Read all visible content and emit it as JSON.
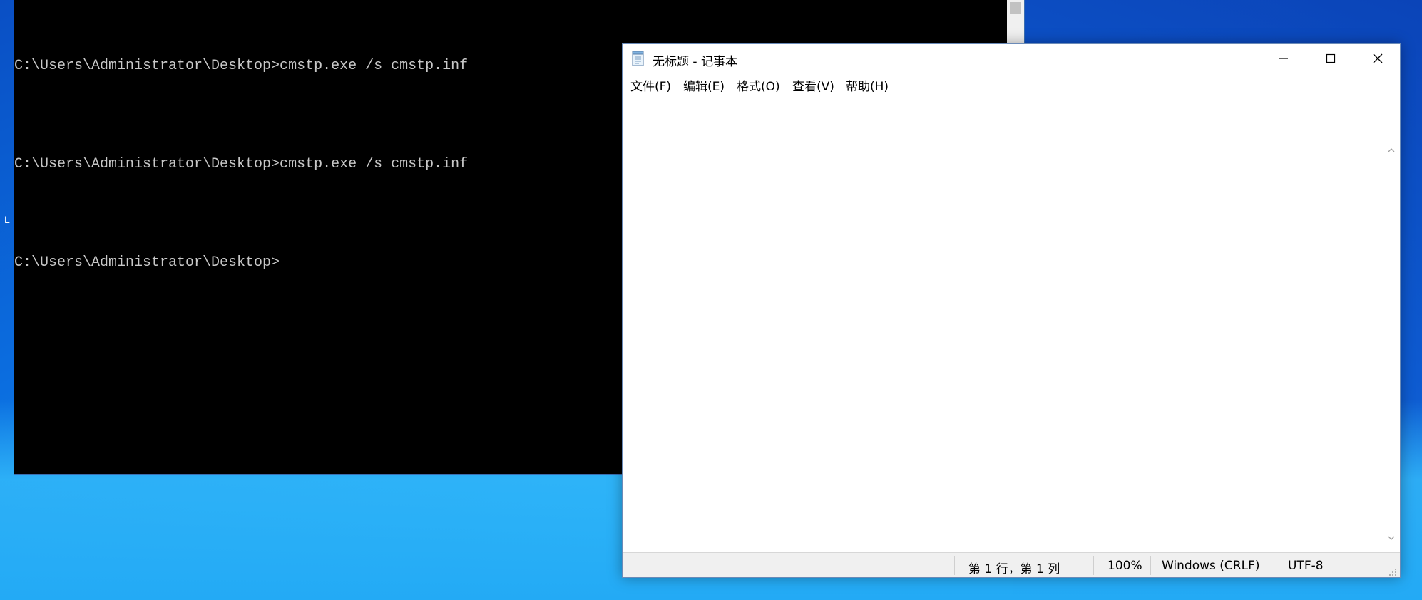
{
  "console": {
    "lines": [
      "C:\\Users\\Administrator\\Desktop>cmstp.exe /s cmstp.inf",
      "C:\\Users\\Administrator\\Desktop>cmstp.exe /s cmstp.inf",
      "C:\\Users\\Administrator\\Desktop>"
    ]
  },
  "notepad": {
    "title": "无标题 - 记事本",
    "menu": {
      "file": "文件(F)",
      "edit": "编辑(E)",
      "format": "格式(O)",
      "view": "查看(V)",
      "help": "帮助(H)"
    },
    "content": "",
    "status": {
      "position": "第 1 行，第 1 列",
      "zoom": "100%",
      "line_ending": "Windows (CRLF)",
      "encoding": "UTF-8"
    },
    "icons": {
      "app": "notepad-icon",
      "minimize": "minimize-icon",
      "maximize": "maximize-icon",
      "close": "close-icon"
    }
  },
  "desktop": {
    "edge_char": "L"
  },
  "colors": {
    "console_bg": "#000000",
    "console_text": "#c8c8c8",
    "desktop_blue": "#1a9df0",
    "statusbar_bg": "#f0f0f0"
  }
}
